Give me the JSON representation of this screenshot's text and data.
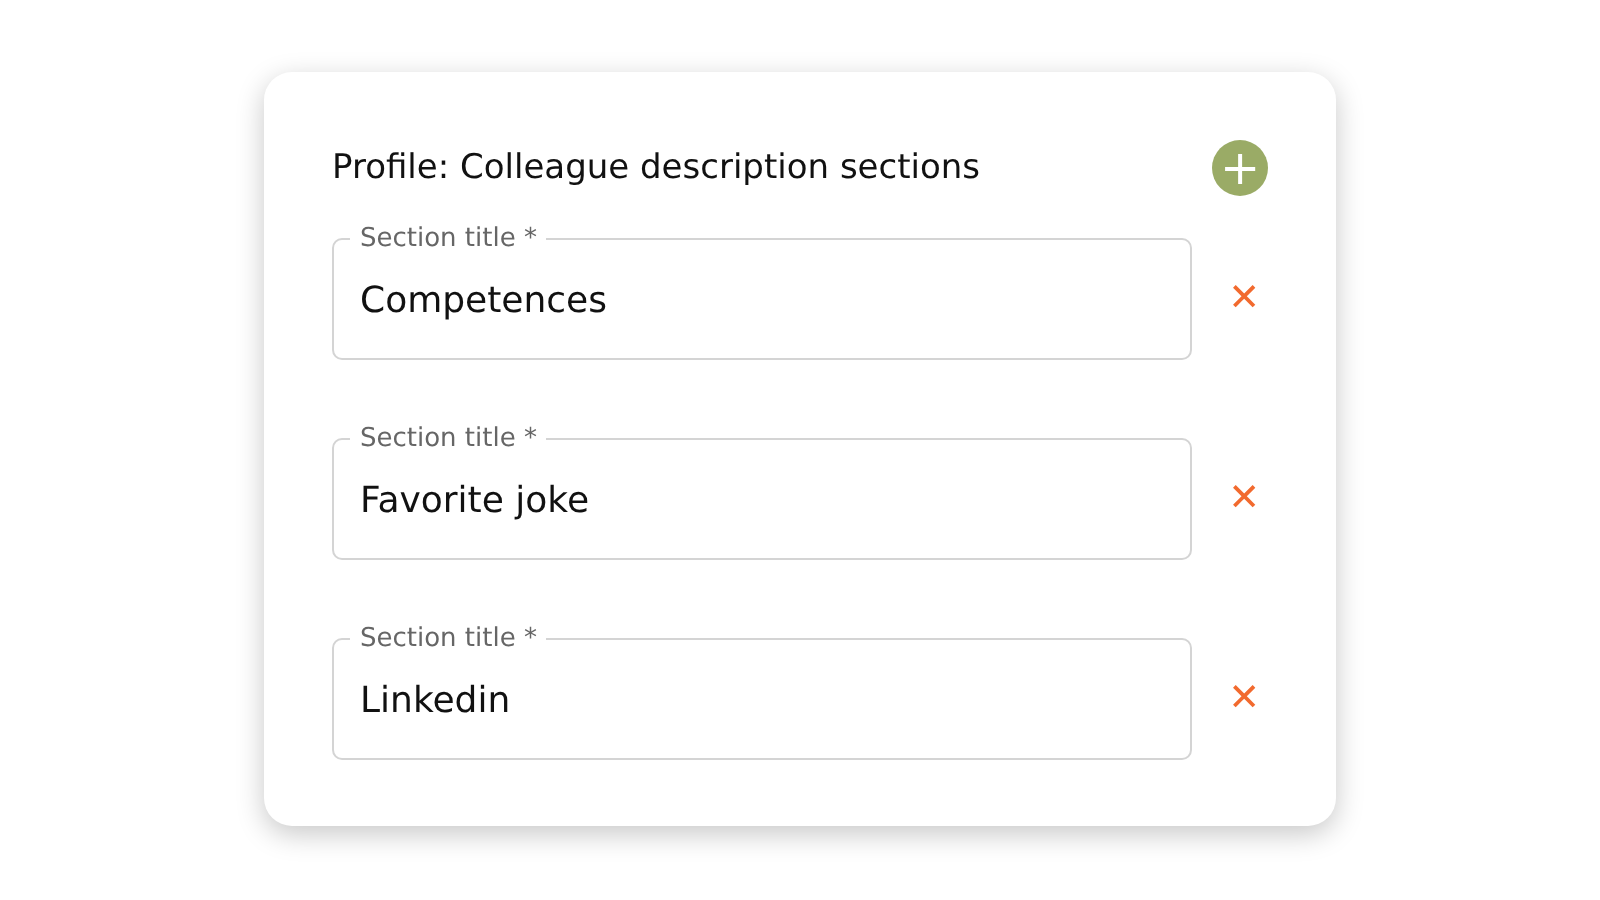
{
  "card": {
    "title": "Profile: Colleague description sections",
    "add_button": "+"
  },
  "sections": [
    {
      "label": "Section title *",
      "value": "Competences",
      "remove": "✕"
    },
    {
      "label": "Section title *",
      "value": "Favorite joke",
      "remove": "✕"
    },
    {
      "label": "Section title *",
      "value": "Linkedin",
      "remove": "✕"
    }
  ]
}
